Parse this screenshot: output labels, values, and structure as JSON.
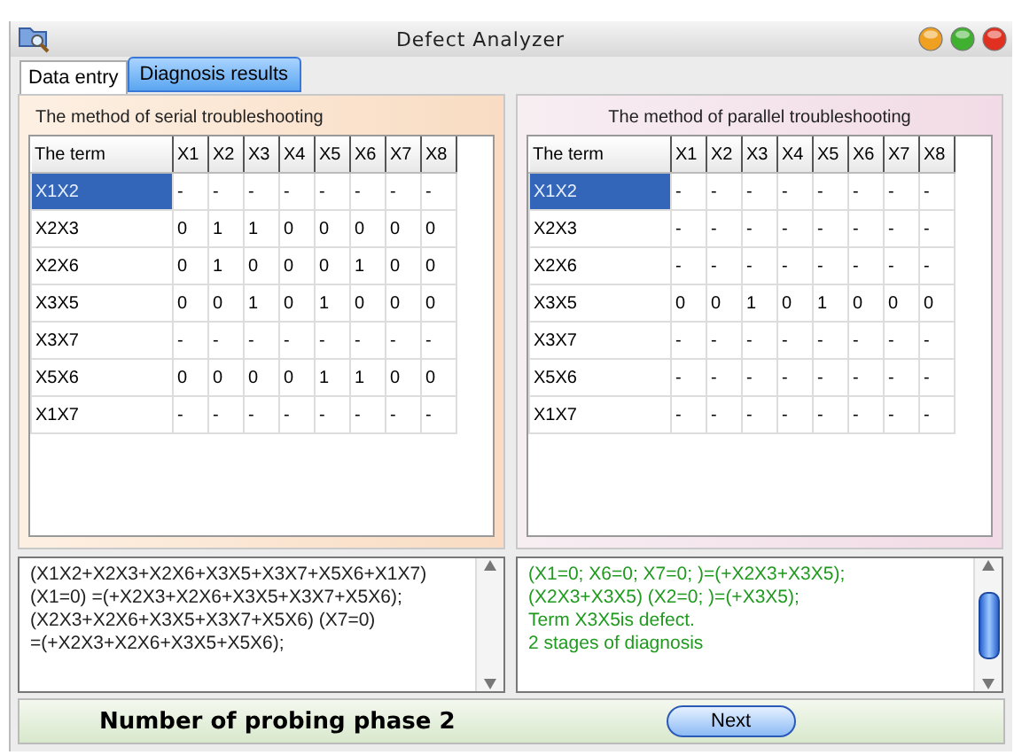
{
  "window": {
    "title": "Defect Analyzer"
  },
  "tabs": [
    {
      "label": "Data entry",
      "selected": false
    },
    {
      "label": "Diagnosis results",
      "selected": true
    }
  ],
  "panels": [
    {
      "title": "The method of serial troubleshooting",
      "columns": [
        "The term",
        "X1",
        "X2",
        "X3",
        "X4",
        "X5",
        "X6",
        "X7",
        "X8"
      ],
      "rows": [
        {
          "cells": [
            "X1X2",
            "-",
            "-",
            "-",
            "-",
            "-",
            "-",
            "-",
            "-"
          ],
          "selected": true
        },
        {
          "cells": [
            "X2X3",
            "0",
            "1",
            "1",
            "0",
            "0",
            "0",
            "0",
            "0"
          ],
          "selected": false
        },
        {
          "cells": [
            "X2X6",
            "0",
            "1",
            "0",
            "0",
            "0",
            "1",
            "0",
            "0"
          ],
          "selected": false
        },
        {
          "cells": [
            "X3X5",
            "0",
            "0",
            "1",
            "0",
            "1",
            "0",
            "0",
            "0"
          ],
          "selected": false
        },
        {
          "cells": [
            "X3X7",
            "-",
            "-",
            "-",
            "-",
            "-",
            "-",
            "-",
            "-"
          ],
          "selected": false
        },
        {
          "cells": [
            "X5X6",
            "0",
            "0",
            "0",
            "0",
            "1",
            "1",
            "0",
            "0"
          ],
          "selected": false
        },
        {
          "cells": [
            "X1X7",
            "-",
            "-",
            "-",
            "-",
            "-",
            "-",
            "-",
            "-"
          ],
          "selected": false
        }
      ],
      "log": [
        "(X1X2+X2X3+X2X6+X3X5+X3X7+X5X6+X1X7)",
        "(X1=0) =(+X2X3+X2X6+X3X5+X3X7+X5X6);",
        "(X2X3+X2X6+X3X5+X3X7+X5X6) (X7=0)",
        "=(+X2X3+X2X6+X3X5+X5X6);"
      ],
      "color": "#222222"
    },
    {
      "title": "The method of parallel troubleshooting",
      "columns": [
        "The term",
        "X1",
        "X2",
        "X3",
        "X4",
        "X5",
        "X6",
        "X7",
        "X8"
      ],
      "rows": [
        {
          "cells": [
            "X1X2",
            "-",
            "-",
            "-",
            "-",
            "-",
            "-",
            "-",
            "-"
          ],
          "selected": true
        },
        {
          "cells": [
            "X2X3",
            "-",
            "-",
            "-",
            "-",
            "-",
            "-",
            "-",
            "-"
          ],
          "selected": false
        },
        {
          "cells": [
            "X2X6",
            "-",
            "-",
            "-",
            "-",
            "-",
            "-",
            "-",
            "-"
          ],
          "selected": false
        },
        {
          "cells": [
            "X3X5",
            "0",
            "0",
            "1",
            "0",
            "1",
            "0",
            "0",
            "0"
          ],
          "selected": false
        },
        {
          "cells": [
            "X3X7",
            "-",
            "-",
            "-",
            "-",
            "-",
            "-",
            "-",
            "-"
          ],
          "selected": false
        },
        {
          "cells": [
            "X5X6",
            "-",
            "-",
            "-",
            "-",
            "-",
            "-",
            "-",
            "-"
          ],
          "selected": false
        },
        {
          "cells": [
            "X1X7",
            "-",
            "-",
            "-",
            "-",
            "-",
            "-",
            "-",
            "-"
          ],
          "selected": false
        }
      ],
      "log": [
        "(X1=0; X6=0; X7=0; )=(+X2X3+X3X5);",
        "(X2X3+X3X5) (X2=0; )=(+X3X5);",
        "Term X3X5is defect.",
        "2 stages of diagnosis"
      ],
      "color": "#1f9a1f"
    }
  ],
  "status": {
    "text": "Number of probing phase 2",
    "button": "Next"
  }
}
